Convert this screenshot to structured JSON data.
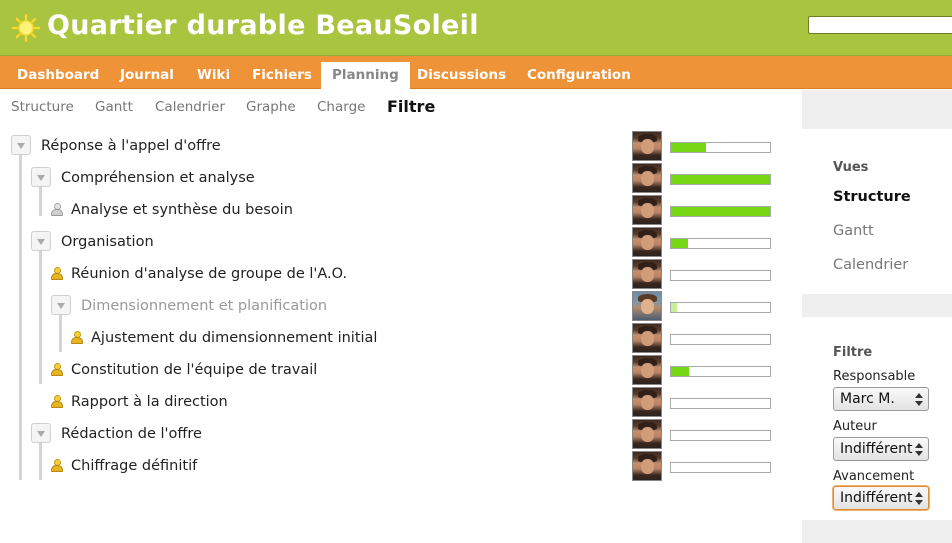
{
  "app": {
    "title": "Quartier durable BeauSoleil",
    "logo_icon": "sun-icon"
  },
  "search": {
    "value": ""
  },
  "tabs": [
    {
      "label": "Dashboard"
    },
    {
      "label": "Journal"
    },
    {
      "label": "Wiki"
    },
    {
      "label": "Fichiers"
    },
    {
      "label": "Planning",
      "active": true
    },
    {
      "label": "Discussions"
    },
    {
      "label": "Configuration"
    }
  ],
  "subtabs": [
    {
      "label": "Structure"
    },
    {
      "label": "Gantt"
    },
    {
      "label": "Calendrier"
    },
    {
      "label": "Graphe"
    },
    {
      "label": "Charge"
    },
    {
      "label": "Filtre",
      "active": true
    }
  ],
  "tasks": [
    {
      "label": "Réponse à l'appel d'offre",
      "type": "group",
      "progress": 0.35
    },
    {
      "label": "Compréhension et analyse",
      "type": "group",
      "progress": 1.0
    },
    {
      "label": "Analyse et synthèse du besoin",
      "type": "task-grey",
      "progress": 1.0
    },
    {
      "label": "Organisation",
      "type": "group",
      "progress": 0.17
    },
    {
      "label": "Réunion d'analyse de groupe de l'A.O.",
      "type": "task",
      "progress": 0.0
    },
    {
      "label": "Dimensionnement et planification",
      "type": "group-muted",
      "progress": 0.06
    },
    {
      "label": "Ajustement du dimensionnement initial",
      "type": "task",
      "progress": 0.0
    },
    {
      "label": "Constitution de l'équipe de travail",
      "type": "task",
      "progress": 0.18
    },
    {
      "label": "Rapport à la direction",
      "type": "task",
      "progress": 0.0
    },
    {
      "label": "Rédaction de l'offre",
      "type": "group",
      "progress": 0.0
    },
    {
      "label": "Chiffrage définitif",
      "type": "task",
      "progress": 0.0
    }
  ],
  "sidebar": {
    "views_heading": "Vues",
    "views": [
      {
        "label": "Structure",
        "active": true
      },
      {
        "label": "Gantt"
      },
      {
        "label": "Calendrier"
      }
    ],
    "filter_heading": "Filtre",
    "filters": [
      {
        "label": "Responsable",
        "value": "Marc M."
      },
      {
        "label": "Auteur",
        "value": "Indifférent"
      },
      {
        "label": "Avancement",
        "value": "Indifférent"
      }
    ]
  },
  "colors": {
    "header": "#a9c43f",
    "tabbar": "#ef9339",
    "progress": "#78d714"
  }
}
